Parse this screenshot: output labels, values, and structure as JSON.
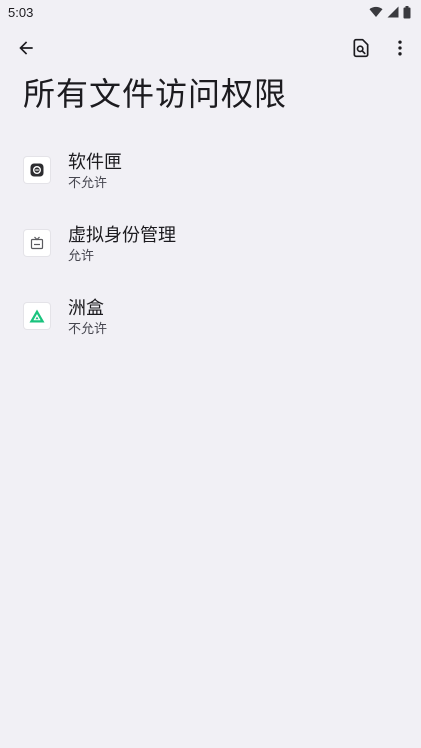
{
  "status_bar": {
    "time": "5:03",
    "icons": [
      "wifi-icon",
      "cellular-signal-icon",
      "battery-icon"
    ]
  },
  "toolbar": {
    "back_icon": "arrow-back-icon",
    "actions": [
      "search-in-page-icon",
      "more-vert-icon"
    ]
  },
  "page": {
    "title": "所有文件访问权限"
  },
  "apps": [
    {
      "name": "软件匣",
      "status": "不允许",
      "icon": "software-box-icon"
    },
    {
      "name": "虚拟身份管理",
      "status": "允许",
      "icon": "virtual-identity-icon"
    },
    {
      "name": "洲盒",
      "status": "不允许",
      "icon": "zhouhe-icon"
    }
  ],
  "colors": {
    "background": "#f1f0f5",
    "text_primary": "#1c1b1f",
    "text_secondary": "#46464f",
    "zhouhe_accent": "#19c37d"
  }
}
